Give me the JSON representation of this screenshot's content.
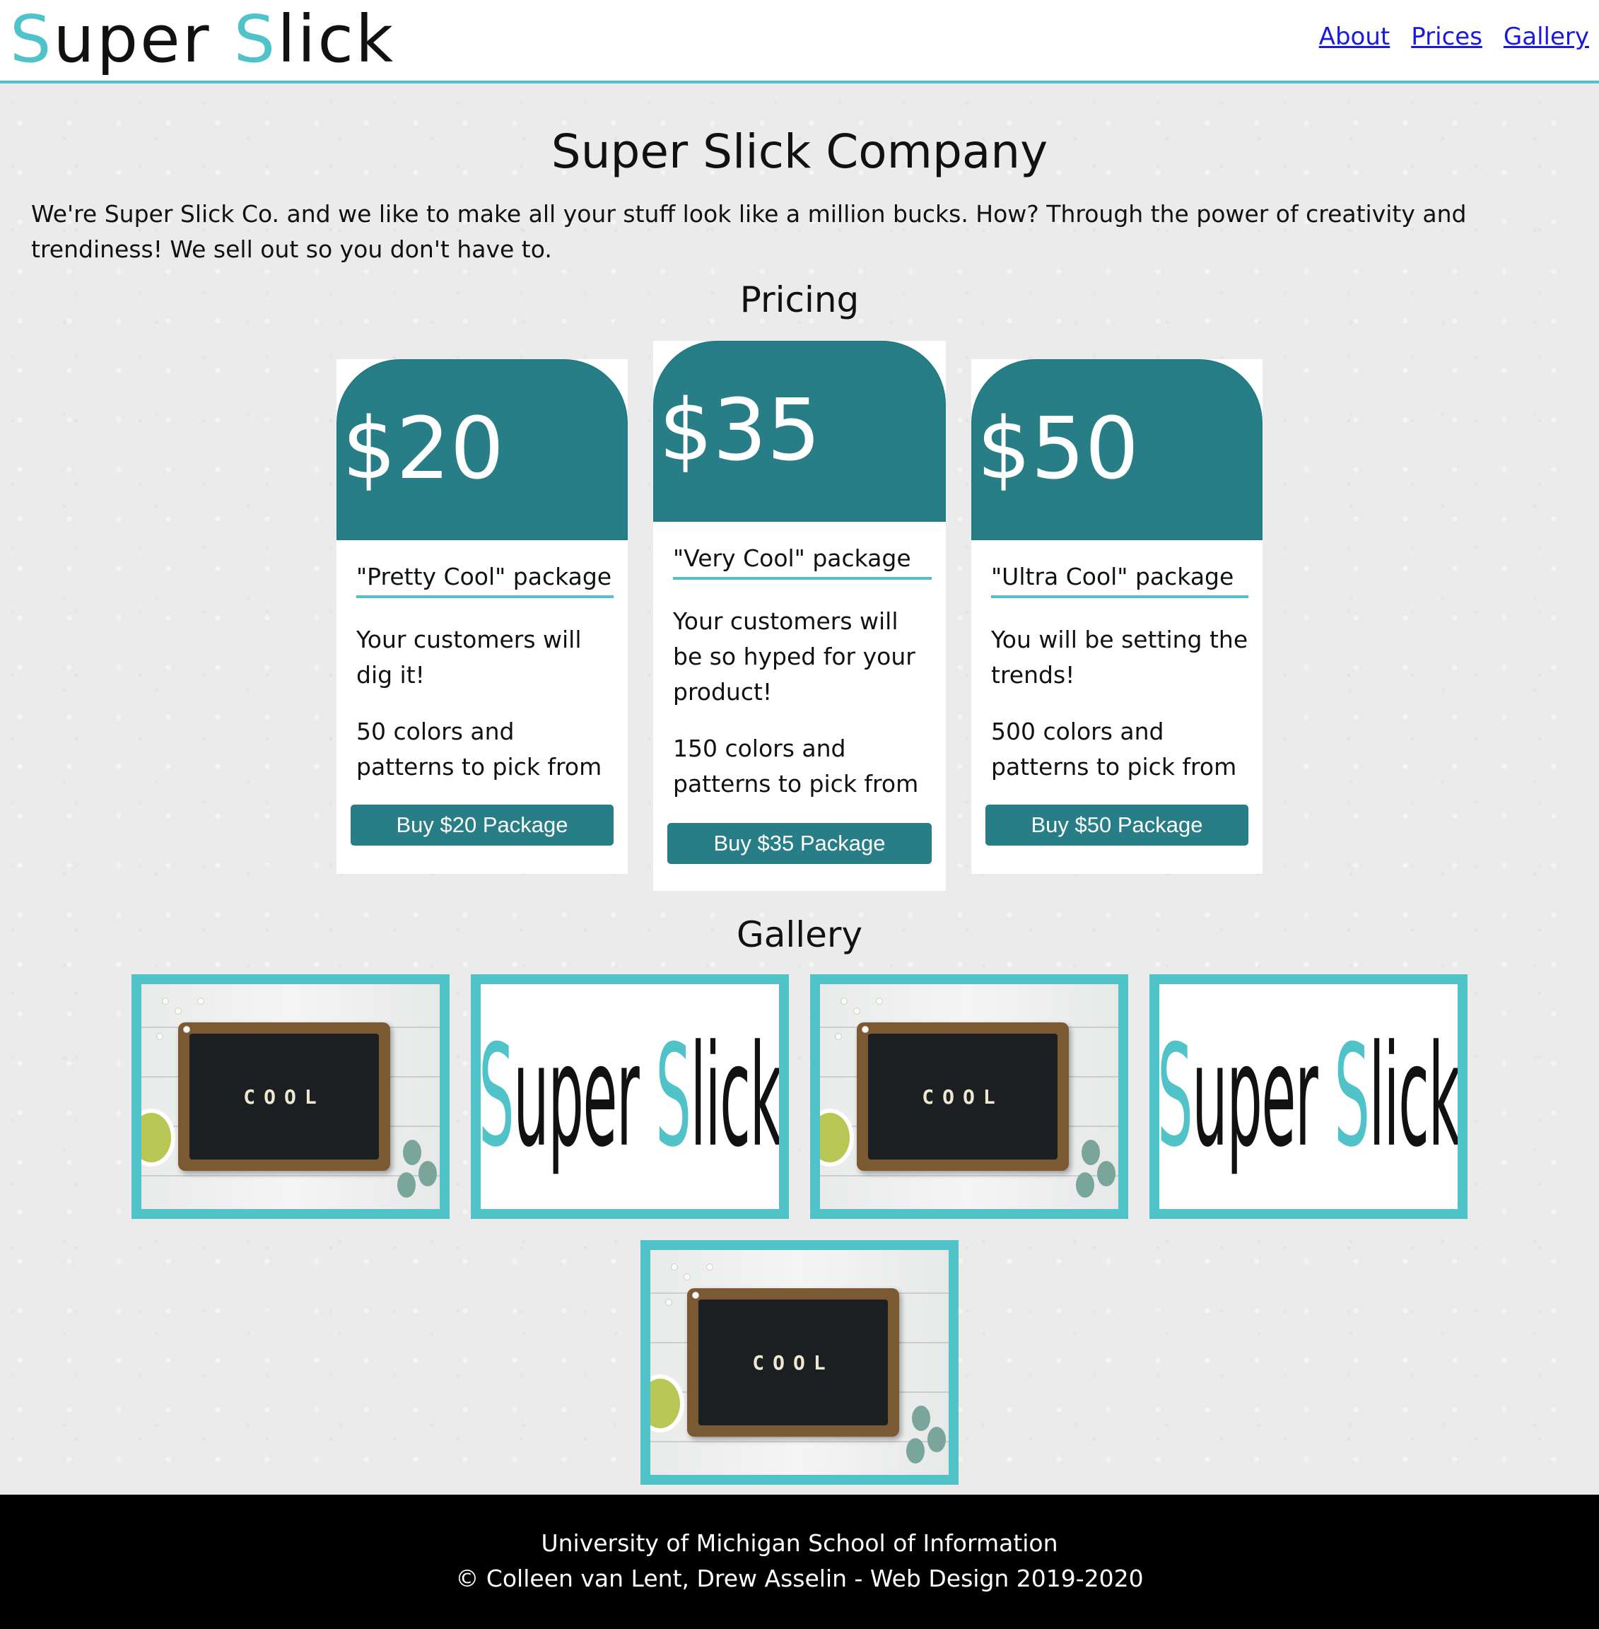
{
  "header": {
    "logo": {
      "part1_initial": "S",
      "part1_rest": "uper",
      "part2_initial": "S",
      "part2_rest": "lick"
    },
    "nav": [
      {
        "label": "About"
      },
      {
        "label": "Prices"
      },
      {
        "label": "Gallery"
      }
    ]
  },
  "main": {
    "title": "Super Slick Company",
    "intro": "We're Super Slick Co. and we like to make all your stuff look like a million bucks. How? Through the power of creativity and trendiness! We sell out so you don't have to."
  },
  "pricing": {
    "title": "Pricing",
    "cards": [
      {
        "price": "$20",
        "package": "\"Pretty Cool\" package",
        "description": "Your customers will dig it!",
        "colors": "50 colors and patterns to pick from",
        "button": "Buy $20 Package"
      },
      {
        "price": "$35",
        "package": "\"Very Cool\" package",
        "description": "Your customers will be so hyped for your product!",
        "colors": "150 colors and patterns to pick from",
        "button": "Buy $35 Package"
      },
      {
        "price": "$50",
        "package": "\"Ultra Cool\" package",
        "description": "You will be setting the trends!",
        "colors": "500 colors and patterns to pick from",
        "button": "Buy $50 Package"
      }
    ]
  },
  "gallery": {
    "title": "Gallery",
    "images": [
      {
        "type": "chalkboard",
        "text": "COOL"
      },
      {
        "type": "logo"
      },
      {
        "type": "chalkboard",
        "text": "COOL"
      },
      {
        "type": "logo"
      },
      {
        "type": "chalkboard",
        "text": "COOL"
      }
    ]
  },
  "footer": {
    "line1": "University of Michigan School of Information",
    "line2": "© Colleen van Lent, Drew Asselin - Web Design 2019-2020"
  },
  "colors": {
    "accent": "#4fc3c8",
    "card_header": "#287e87",
    "link": "#1a1adf"
  }
}
